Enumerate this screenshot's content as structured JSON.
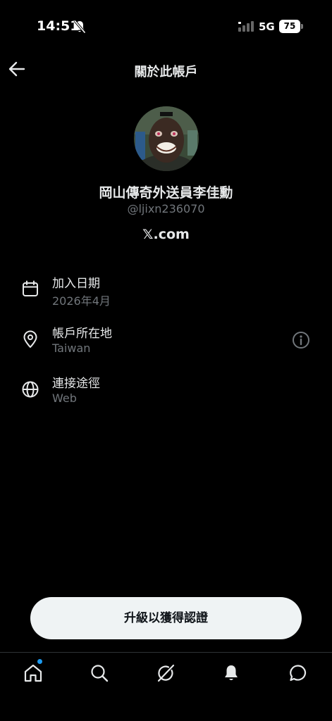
{
  "status_bar": {
    "time": "14:51",
    "network": "5G",
    "battery": "75"
  },
  "header": {
    "title": "關於此帳戶"
  },
  "profile": {
    "display_name": "岡山傳奇外送員李佳勳",
    "handle": "@ljixn236070",
    "site": "𝕏.com"
  },
  "info": {
    "joined": {
      "label": "加入日期",
      "value": "2026年4月"
    },
    "location": {
      "label": "帳戶所在地",
      "value": "Taiwan"
    },
    "connected_via": {
      "label": "連接途徑",
      "value": "Web"
    }
  },
  "upgrade_button": "升級以獲得認證",
  "bottom_nav": {
    "items": [
      "home-icon",
      "search-icon",
      "grok-icon",
      "notifications-icon",
      "messages-icon"
    ],
    "accent": "#1d9bf0"
  },
  "colors": {
    "background": "#000000",
    "primary_text": "#e7e9ea",
    "secondary_text": "#71767b",
    "button_bg": "#eff3f4"
  }
}
